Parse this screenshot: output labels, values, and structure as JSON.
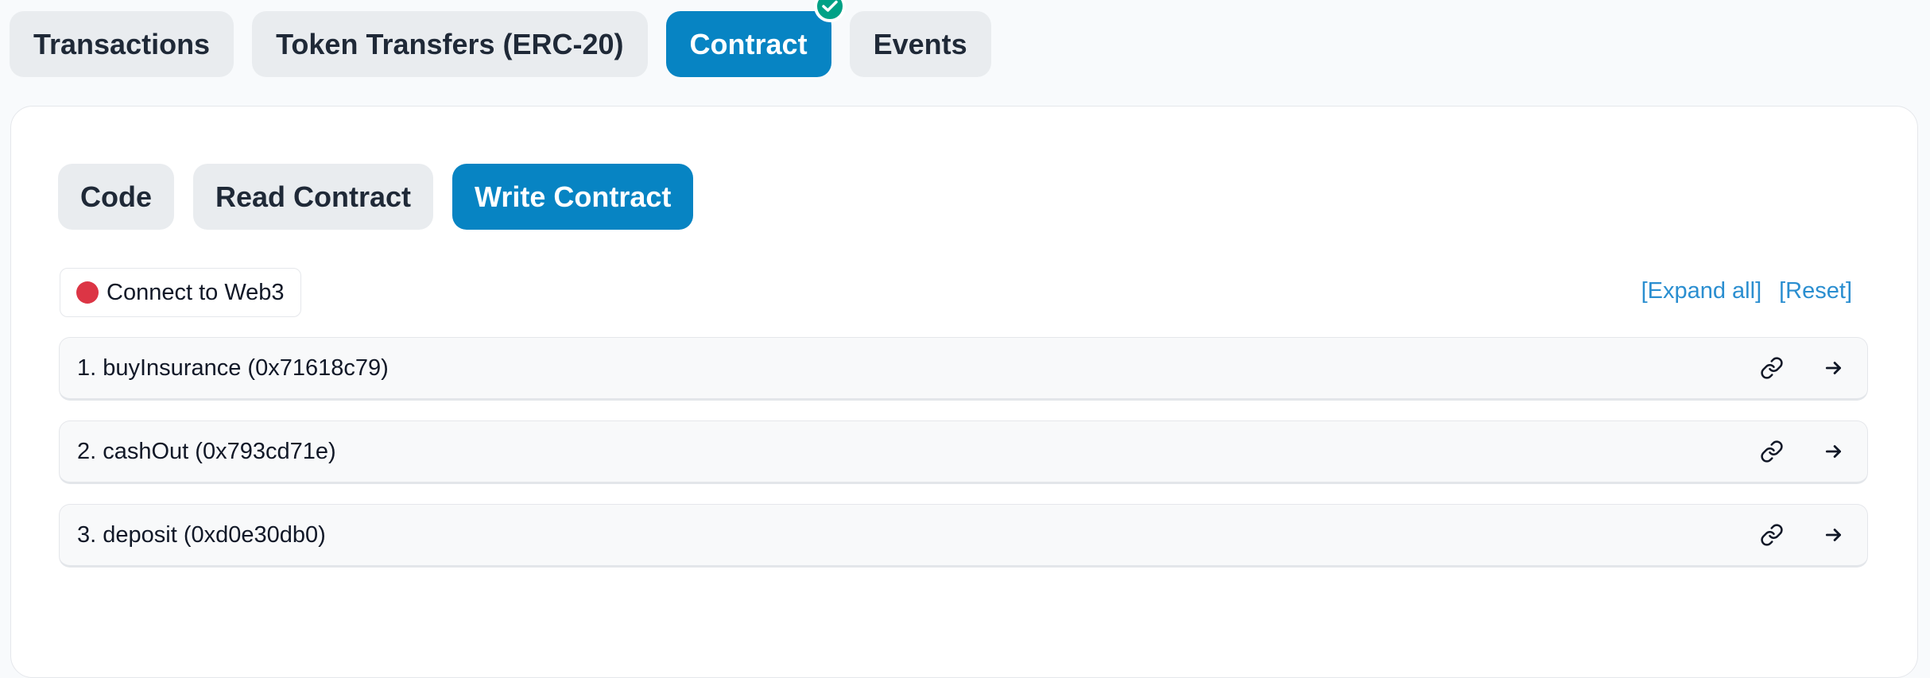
{
  "top_tabs": [
    {
      "label": "Transactions",
      "active": false
    },
    {
      "label": "Token Transfers (ERC-20)",
      "active": false
    },
    {
      "label": "Contract",
      "active": true,
      "verified_icon": "check-circle-icon"
    },
    {
      "label": "Events",
      "active": false
    }
  ],
  "sub_tabs": [
    {
      "label": "Code",
      "active": false
    },
    {
      "label": "Read Contract",
      "active": false
    },
    {
      "label": "Write Contract",
      "active": true
    }
  ],
  "connect": {
    "label": "Connect to Web3",
    "status_color": "#dc3545"
  },
  "actions": {
    "expand_all": "[Expand all]",
    "reset": "[Reset]"
  },
  "functions": [
    {
      "label": "1. buyInsurance (0x71618c79)",
      "icons": [
        "link-icon",
        "arrow-right-icon"
      ]
    },
    {
      "label": "2. cashOut (0x793cd71e)",
      "icons": [
        "link-icon",
        "arrow-right-icon"
      ]
    },
    {
      "label": "3. deposit (0xd0e30db0)",
      "icons": [
        "link-icon",
        "arrow-right-icon"
      ]
    }
  ],
  "colors": {
    "accent": "#0784c3",
    "verified": "#00a186",
    "tab_bg": "#e9ecef"
  }
}
